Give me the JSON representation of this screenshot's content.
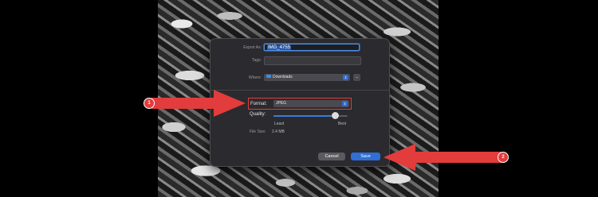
{
  "dialog": {
    "export_as_label": "Export As:",
    "export_as_value": "IMG_4755",
    "tags_label": "Tags:",
    "tags_value": "",
    "where_label": "Where:",
    "where_value": "Downloads",
    "format_label": "Format:",
    "format_value": "JPEG",
    "quality_label": "Quality:",
    "quality_fraction": 0.83,
    "quality_least": "Least",
    "quality_best": "Best",
    "file_size_label": "File Size:",
    "file_size_value": "2.4 MB",
    "cancel_label": "Cancel",
    "save_label": "Save"
  },
  "annotations": {
    "badge1": "1",
    "badge2": "2",
    "arrow_color": "#e23c3c"
  },
  "icons": [
    "folder-icon",
    "stepper-icon",
    "expand-chevron-icon",
    "arrow-annotation-icon"
  ]
}
